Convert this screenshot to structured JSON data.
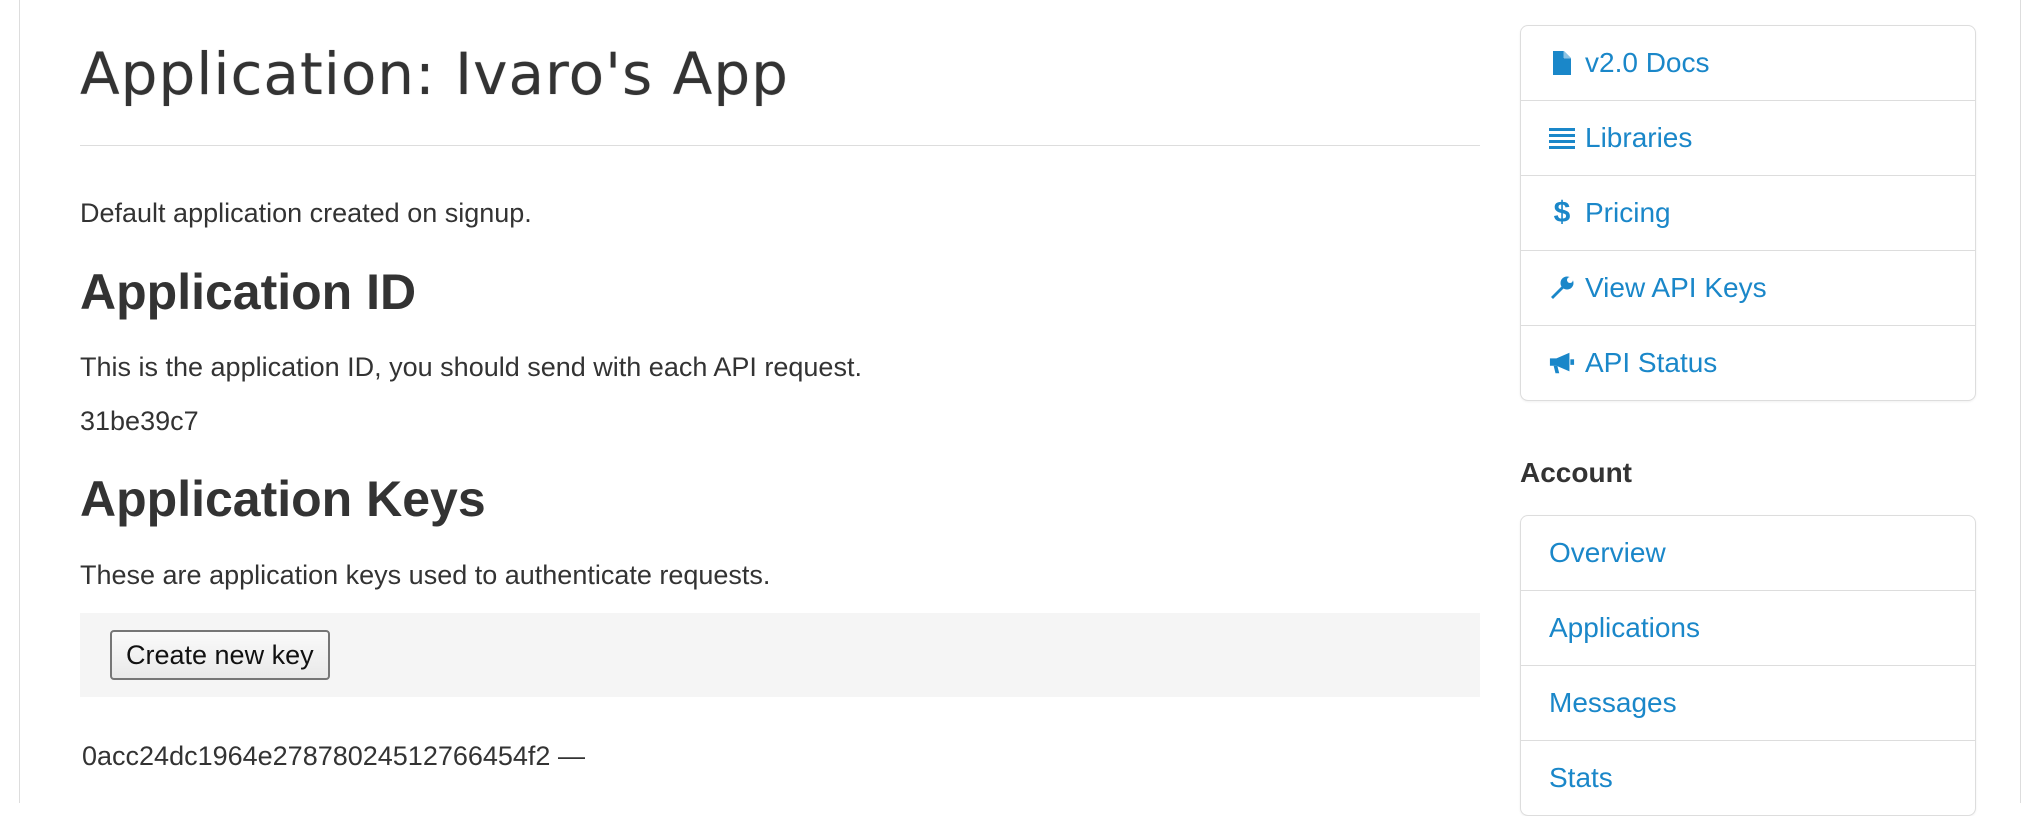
{
  "main": {
    "title": "Application: Ivaro's App",
    "description": "Default application created on signup.",
    "app_id_section": {
      "heading": "Application ID",
      "text": "This is the application ID, you should send with each API request.",
      "value": "31be39c7"
    },
    "keys_section": {
      "heading": "Application Keys",
      "text": "These are application keys used to authenticate requests.",
      "create_button_label": "Create new key",
      "keys": [
        {
          "value": "0acc24dc1964e27878024512766454f2",
          "suffix": "—"
        }
      ]
    }
  },
  "sidebar": {
    "links": [
      {
        "label": "v2.0 Docs",
        "icon": "file-icon"
      },
      {
        "label": "Libraries",
        "icon": "list-icon"
      },
      {
        "label": "Pricing",
        "icon": "dollar-icon"
      },
      {
        "label": "View API Keys",
        "icon": "wrench-icon"
      },
      {
        "label": "API Status",
        "icon": "bullhorn-icon"
      }
    ],
    "account_heading": "Account",
    "account_links": [
      {
        "label": "Overview"
      },
      {
        "label": "Applications"
      },
      {
        "label": "Messages"
      },
      {
        "label": "Stats"
      }
    ]
  },
  "colors": {
    "link": "#1a87c9",
    "text": "#333333",
    "border": "#dddddd",
    "toolbar_bg": "#f5f5f5"
  }
}
